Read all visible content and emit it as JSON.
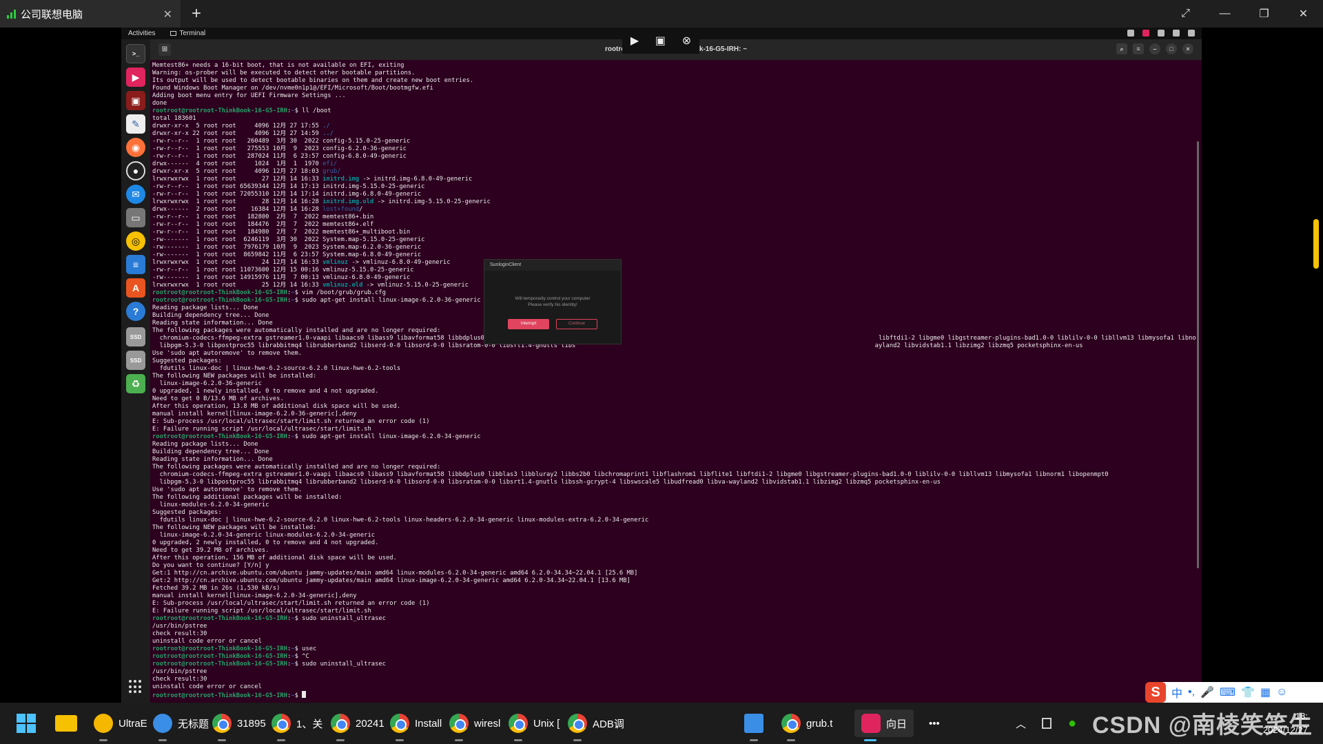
{
  "remote_app": {
    "tab_title": "公司联想电脑",
    "tab_close": "✕",
    "new_tab": "+",
    "window_controls": [
      "⤢",
      "—",
      "❐",
      "✕"
    ]
  },
  "gnome": {
    "activities": "Activities",
    "app_label": "Terminal"
  },
  "remote_toolbar": [
    "▶",
    "▣",
    "⊗"
  ],
  "terminal": {
    "title": "rootroot@rootroot-ThinkBook-16-G5-IRH: ~",
    "prompt_user": "rootroot@rootroot-ThinkBook-16-G5-IRH",
    "prompt_path": "~",
    "lines": [
      {
        "t": "Memtest86+ needs a 16-bit boot, that is not available on EFI, exiting"
      },
      {
        "t": "Warning: os-prober will be executed to detect other bootable partitions."
      },
      {
        "t": "Its output will be used to detect bootable binaries on them and create new boot entries."
      },
      {
        "t": "Found Windows Boot Manager on /dev/nvme0n1p1@/EFI/Microsoft/Boot/bootmgfw.efi"
      },
      {
        "t": "Adding boot menu entry for UEFI Firmware Settings ..."
      },
      {
        "t": "done"
      },
      {
        "p": true,
        "t": "ll /boot"
      },
      {
        "t": "total 183601"
      },
      {
        "t": "drwxr-xr-x  5 root root     4096 12月 27 17:55 ",
        "a": "./",
        "ac": "c-blue"
      },
      {
        "t": "drwxr-xr-x 22 root root     4096 12月 27 14:59 ",
        "a": "../",
        "ac": "c-blue"
      },
      {
        "t": "-rw-r--r--  1 root root   260489  3月 30  2022 config-5.15.0-25-generic"
      },
      {
        "t": "-rw-r--r--  1 root root   275553 10月  9  2023 config-6.2.0-36-generic"
      },
      {
        "t": "-rw-r--r--  1 root root   287024 11月  6 23:57 config-6.8.0-49-generic"
      },
      {
        "t": "drwx------  4 root root     1024  1月  1  1970 ",
        "a": "efi/",
        "ac": "c-dim"
      },
      {
        "t": "drwxr-xr-x  5 root root     4096 12月 27 18:03 ",
        "a": "grub/",
        "ac": "c-dim"
      },
      {
        "t": "lrwxrwxrwx  1 root root       27 12月 14 16:33 ",
        "a": "initrd.img",
        "ac": "c-cyan",
        "b": " -> initrd.img-6.8.0-49-generic"
      },
      {
        "t": "-rw-r--r--  1 root root 65639344 12月 14 17:13 initrd.img-5.15.0-25-generic"
      },
      {
        "t": "-rw-r--r--  1 root root 72055310 12月 14 17:14 initrd.img-6.8.0-49-generic"
      },
      {
        "t": "lrwxrwxrwx  1 root root       28 12月 14 16:28 ",
        "a": "initrd.img.old",
        "ac": "c-cyan",
        "b": " -> initrd.img-5.15.0-25-generic"
      },
      {
        "t": "drwx------  2 root root    16384 12月 14 16:28 ",
        "a": "lost+found",
        "ac": "c-dim",
        "b": "/"
      },
      {
        "t": "-rw-r--r--  1 root root   182800  2月  7  2022 memtest86+.bin"
      },
      {
        "t": "-rw-r--r--  1 root root   184476  2月  7  2022 memtest86+.elf"
      },
      {
        "t": "-rw-r--r--  1 root root   184980  2月  7  2022 memtest86+_multiboot.bin"
      },
      {
        "t": "-rw-------  1 root root  6246119  3月 30  2022 System.map-5.15.0-25-generic"
      },
      {
        "t": "-rw-------  1 root root  7976179 10月  9  2023 System.map-6.2.0-36-generic"
      },
      {
        "t": "-rw-------  1 root root  8659842 11月  6 23:57 System.map-6.8.0-49-generic"
      },
      {
        "t": "lrwxrwxrwx  1 root root       24 12月 14 16:33 ",
        "a": "vmlinuz",
        "ac": "c-cyan",
        "b": " -> vmlinuz-6.8.0-49-generic"
      },
      {
        "t": "-rw-r--r--  1 root root 11073600 12月 15 00:16 vmlinuz-5.15.0-25-generic"
      },
      {
        "t": "-rw-------  1 root root 14915976 11月  7 00:13 vmlinuz-6.8.0-49-generic"
      },
      {
        "t": "lrwxrwxrwx  1 root root       25 12月 14 16:33 ",
        "a": "vmlinuz.old",
        "ac": "c-cyan",
        "b": " -> vmlinuz-5.15.0-25-generic"
      },
      {
        "p": true,
        "t": "vim /boot/grub/grub.cfg"
      },
      {
        "p": true,
        "t": "sudo apt-get install linux-image-6.2.0-36-generic"
      },
      {
        "t": "Reading package lists... Done"
      },
      {
        "t": "Building dependency tree... Done"
      },
      {
        "t": "Reading state information... Done"
      },
      {
        "t": "The following packages were automatically installed and are no longer required:"
      },
      {
        "t": "  chromium-codecs-ffmpeg-extra gstreamer1.0-vaapi libaacs0 libass9 libavformat58 libbdplus0 libblas3 libbluray2 libb                                                                                   libftdi1-2 libgme0 libgstreamer-plugins-bad1.0-0 liblilv-0-0 libllvm13 libmysofa1 libnorm1 libopenmpt0"
      },
      {
        "t": "  libpgm-5.3-0 libpostproc55 librabbitmq4 librubberband2 libserd-0-0 libsord-0-0 libsratom-0-0 libsrt1.4-gnutls libs                                                                                  ayland2 libvidstab1.1 libzimg2 libzmq5 pocketsphinx-en-us"
      },
      {
        "t": "Use 'sudo apt autoremove' to remove them."
      },
      {
        "t": "Suggested packages:"
      },
      {
        "t": "  fdutils linux-doc | linux-hwe-6.2-source-6.2.0 linux-hwe-6.2-tools"
      },
      {
        "t": "The following NEW packages will be installed:"
      },
      {
        "t": "  linux-image-6.2.0-36-generic"
      },
      {
        "t": "0 upgraded, 1 newly installed, 0 to remove and 4 not upgraded."
      },
      {
        "t": "Need to get 0 B/13.6 MB of archives."
      },
      {
        "t": "After this operation, 13.8 MB of additional disk space will be used."
      },
      {
        "t": "manual install kernel[linux-image-6.2.0-36-generic],deny"
      },
      {
        "t": "E: Sub-process /usr/local/ultrasec/start/limit.sh returned an error code (1)"
      },
      {
        "t": "E: Failure running script /usr/local/ultrasec/start/limit.sh"
      },
      {
        "p": true,
        "t": "sudo apt-get install linux-image-6.2.0-34-generic"
      },
      {
        "t": "Reading package lists... Done"
      },
      {
        "t": "Building dependency tree... Done"
      },
      {
        "t": "Reading state information... Done"
      },
      {
        "t": "The following packages were automatically installed and are no longer required:"
      },
      {
        "t": "  chromium-codecs-ffmpeg-extra gstreamer1.0-vaapi libaacs0 libass9 libavformat58 libbdplus0 libblas3 libbluray2 libbs2b0 libchromaprint1 libflashrom1 libflite1 libftdi1-2 libgme0 libgstreamer-plugins-bad1.0-0 liblilv-0-0 libllvm13 libmysofa1 libnorm1 libopenmpt0"
      },
      {
        "t": "  libpgm-5.3-0 libpostproc55 librabbitmq4 librubberband2 libserd-0-0 libsord-0-0 libsratom-0-0 libsrt1.4-gnutls libssh-gcrypt-4 libswscale5 libudfread0 libva-wayland2 libvidstab1.1 libzimg2 libzmq5 pocketsphinx-en-us"
      },
      {
        "t": "Use 'sudo apt autoremove' to remove them."
      },
      {
        "t": "The following additional packages will be installed:"
      },
      {
        "t": "  linux-modules-6.2.0-34-generic"
      },
      {
        "t": "Suggested packages:"
      },
      {
        "t": "  fdutils linux-doc | linux-hwe-6.2-source-6.2.0 linux-hwe-6.2-tools linux-headers-6.2.0-34-generic linux-modules-extra-6.2.0-34-generic"
      },
      {
        "t": "The following NEW packages will be installed:"
      },
      {
        "t": "  linux-image-6.2.0-34-generic linux-modules-6.2.0-34-generic"
      },
      {
        "t": "0 upgraded, 2 newly installed, 0 to remove and 4 not upgraded."
      },
      {
        "t": "Need to get 39.2 MB of archives."
      },
      {
        "t": "After this operation, 156 MB of additional disk space will be used."
      },
      {
        "t": "Do you want to continue? [Y/n] y"
      },
      {
        "t": "Get:1 http://cn.archive.ubuntu.com/ubuntu jammy-updates/main amd64 linux-modules-6.2.0-34-generic amd64 6.2.0-34.34~22.04.1 [25.6 MB]"
      },
      {
        "t": "Get:2 http://cn.archive.ubuntu.com/ubuntu jammy-updates/main amd64 linux-image-6.2.0-34-generic amd64 6.2.0-34.34~22.04.1 [13.6 MB]"
      },
      {
        "t": "Fetched 39.2 MB in 26s (1,530 kB/s)"
      },
      {
        "t": "manual install kernel[linux-image-6.2.0-34-generic],deny"
      },
      {
        "t": "E: Sub-process /usr/local/ultrasec/start/limit.sh returned an error code (1)"
      },
      {
        "t": "E: Failure running script /usr/local/ultrasec/start/limit.sh"
      },
      {
        "p": true,
        "t": "sudo uninstall_ultrasec"
      },
      {
        "t": "/usr/bin/pstree"
      },
      {
        "t": "check result:30"
      },
      {
        "t": "uninstall code error or cancel"
      },
      {
        "p": true,
        "t": "usec"
      },
      {
        "p": true,
        "t": "^C"
      },
      {
        "p": true,
        "t": "sudo uninstall_ultrasec"
      },
      {
        "t": "/usr/bin/pstree"
      },
      {
        "t": "check result:30"
      },
      {
        "t": "uninstall code error or cancel"
      },
      {
        "p": true,
        "t": ""
      }
    ]
  },
  "dialog": {
    "title": "SunloginClient",
    "message_1": "Will temporarily control your computer",
    "message_2": "Please verify his identity!",
    "interrupt_label": "Interrupt",
    "continue_label": "Continue"
  },
  "taskbar": {
    "items": [
      {
        "label": "UltraE",
        "icon": "ultraedit-icon",
        "color": "#f5b700"
      },
      {
        "label": "无标题",
        "icon": "paint-icon",
        "color": "#3a8ee6"
      },
      {
        "label": "31895",
        "icon": "chrome-icon"
      },
      {
        "label": "1、关",
        "icon": "chrome-icon"
      },
      {
        "label": "20241",
        "icon": "chrome-icon"
      },
      {
        "label": "Install",
        "icon": "chrome-icon"
      },
      {
        "label": "wiresl",
        "icon": "chrome-icon"
      },
      {
        "label": "Unix [",
        "icon": "chrome-icon"
      },
      {
        "label": "ADB调",
        "icon": "chrome-icon"
      },
      {
        "label": "",
        "icon": "notepad-icon",
        "color": "#3a8ee6"
      },
      {
        "label": "grub.t",
        "icon": "chrome-icon"
      },
      {
        "label": "向日",
        "icon": "sunlogin-icon",
        "color": "#e0245e"
      }
    ],
    "more": "•••",
    "ime": [
      "中",
      "•,",
      "🎤",
      "⌨",
      "👕",
      "▦",
      "☺"
    ],
    "clock_time": "18:",
    "clock_date": "2024/12/27"
  },
  "watermark": "CSDN @南棱笑笑生"
}
